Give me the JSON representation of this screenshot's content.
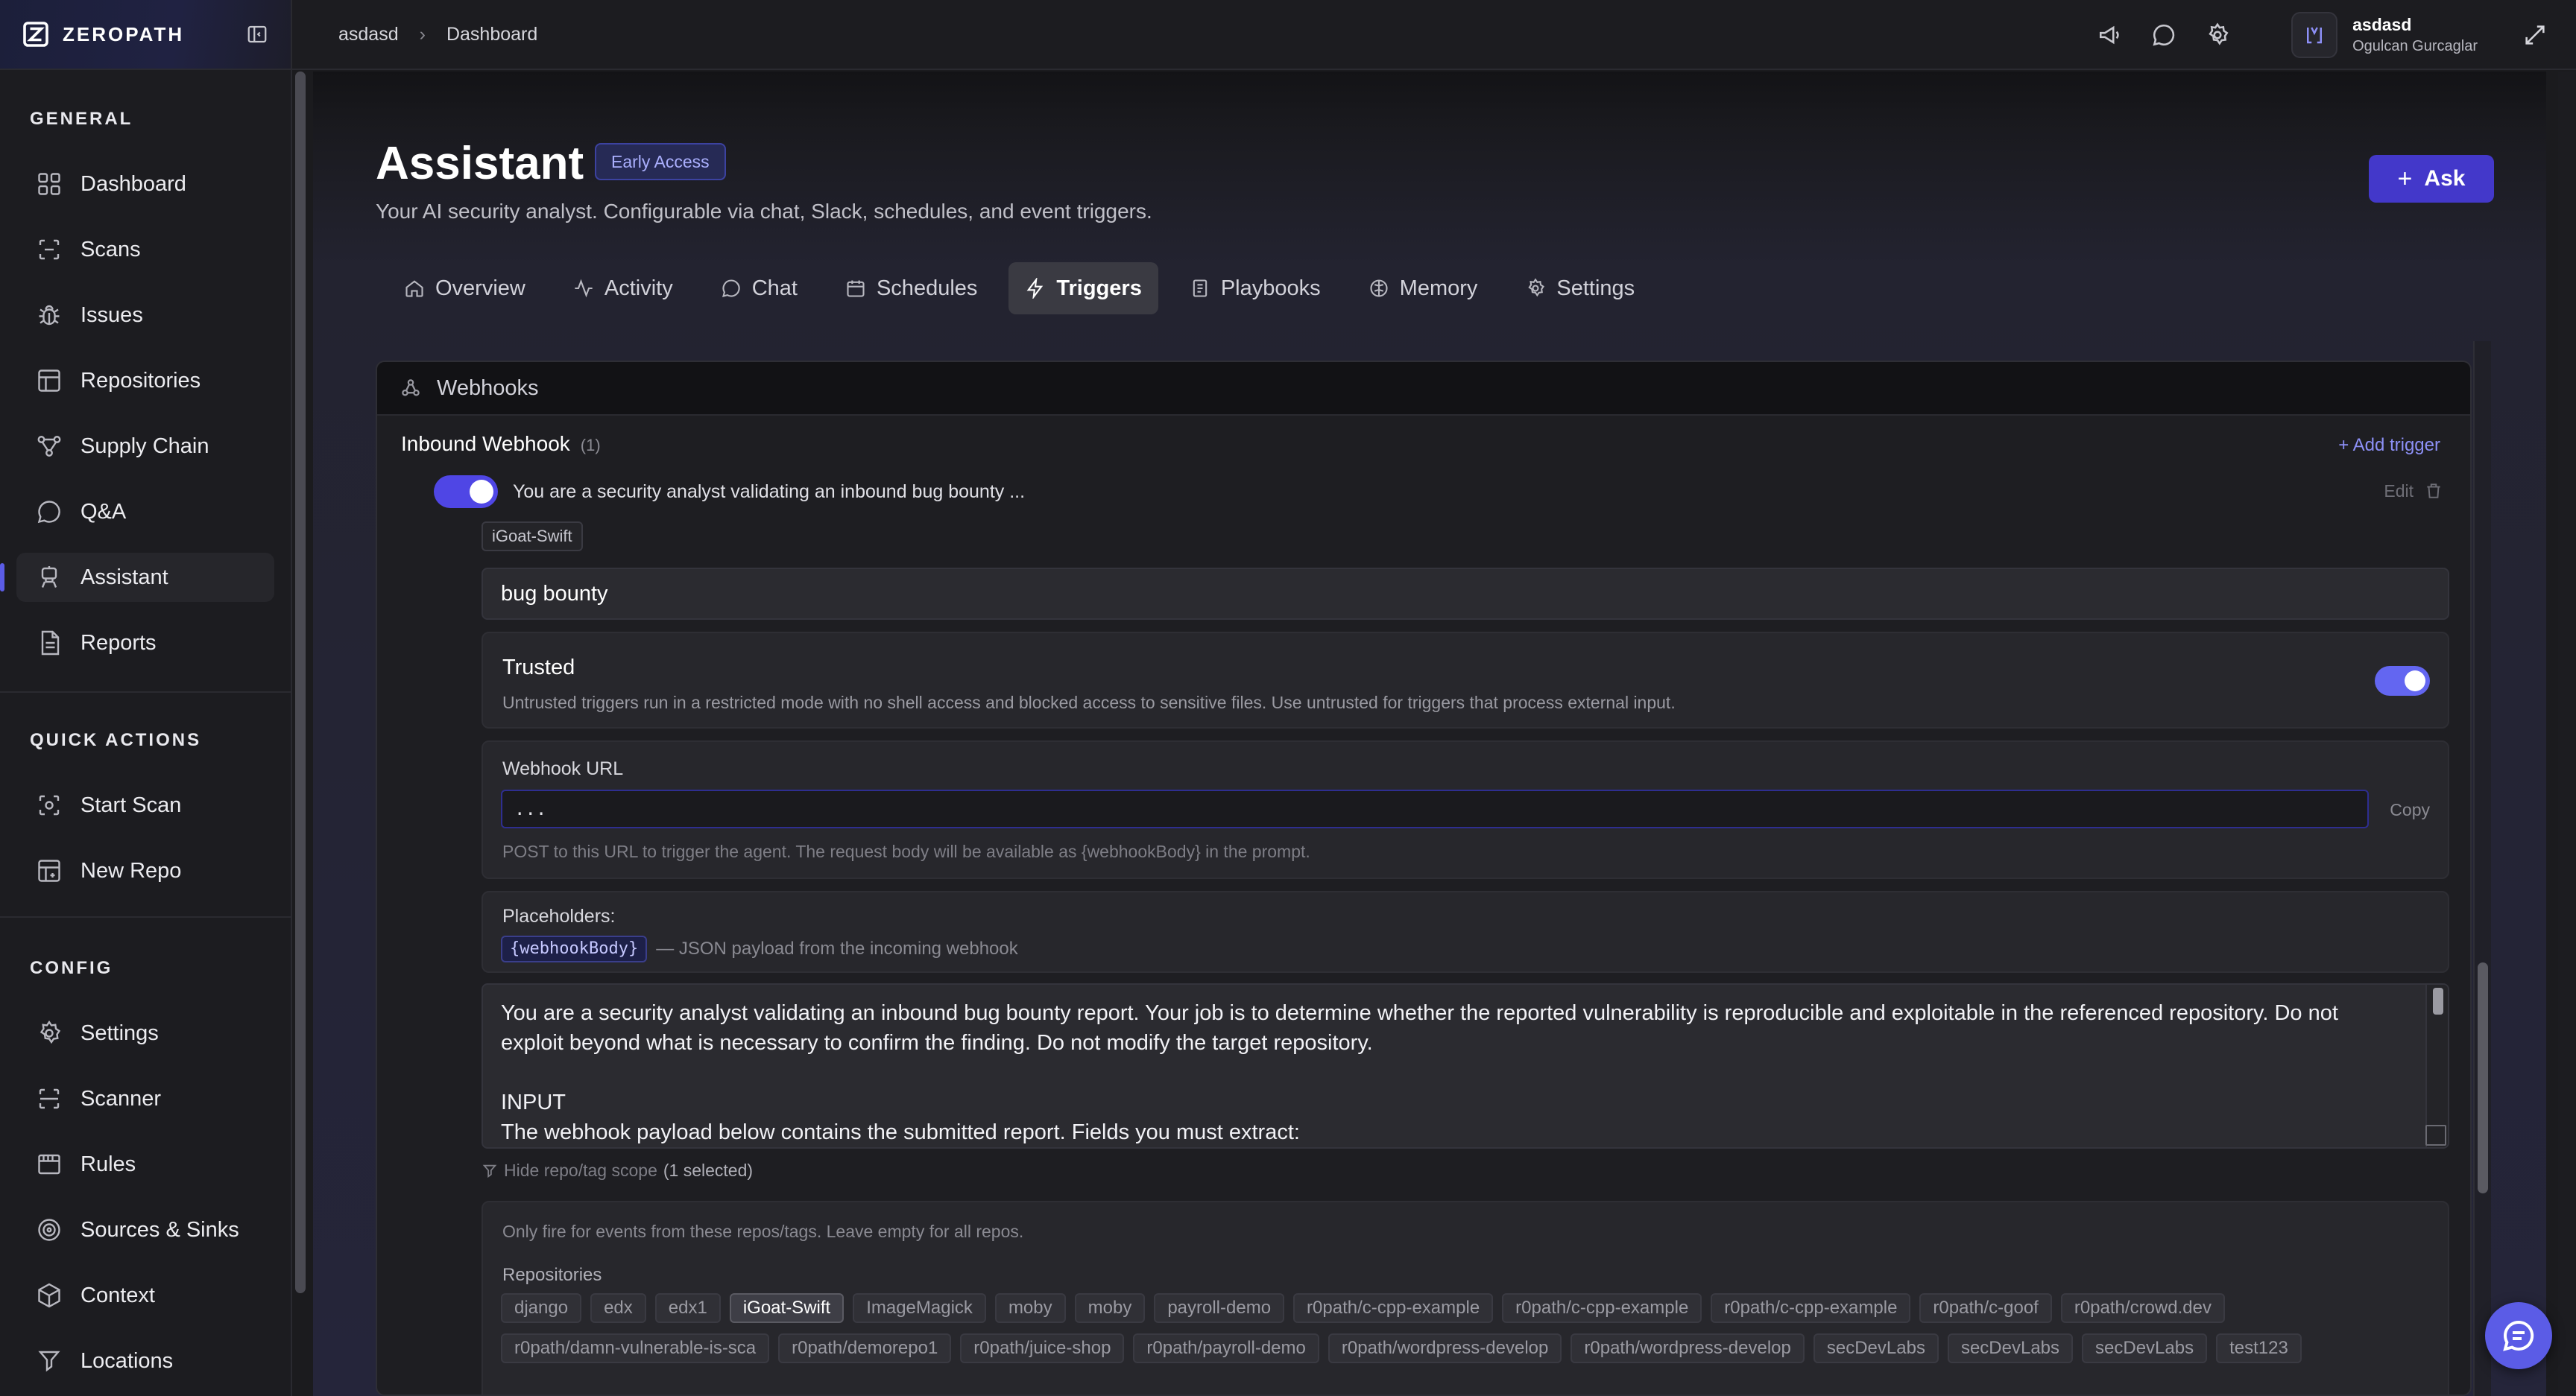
{
  "brand": {
    "name": "ZEROPATH"
  },
  "sidebar": {
    "general_title": "GENERAL",
    "general": [
      {
        "label": "Dashboard"
      },
      {
        "label": "Scans"
      },
      {
        "label": "Issues"
      },
      {
        "label": "Repositories"
      },
      {
        "label": "Supply Chain"
      },
      {
        "label": "Q&A"
      },
      {
        "label": "Assistant",
        "active": true
      },
      {
        "label": "Reports"
      }
    ],
    "quick_title": "QUICK ACTIONS",
    "quick": [
      {
        "label": "Start Scan"
      },
      {
        "label": "New Repo"
      }
    ],
    "config_title": "CONFIG",
    "config": [
      {
        "label": "Settings"
      },
      {
        "label": "Scanner"
      },
      {
        "label": "Rules"
      },
      {
        "label": "Sources & Sinks"
      },
      {
        "label": "Context"
      },
      {
        "label": "Locations"
      }
    ]
  },
  "topbar": {
    "breadcrumb": [
      "asdasd",
      "Dashboard"
    ],
    "user": {
      "org": "asdasd",
      "name": "Ogulcan Gurcaglar"
    }
  },
  "page": {
    "title": "Assistant",
    "badge": "Early Access",
    "subtitle": "Your AI security analyst. Configurable via chat, Slack, schedules, and event triggers.",
    "ask_label": "Ask"
  },
  "tabs": [
    {
      "label": "Overview",
      "icon": "home-icon"
    },
    {
      "label": "Activity",
      "icon": "activity-icon"
    },
    {
      "label": "Chat",
      "icon": "chat-icon"
    },
    {
      "label": "Schedules",
      "icon": "calendar-icon"
    },
    {
      "label": "Triggers",
      "icon": "bolt-icon",
      "active": true
    },
    {
      "label": "Playbooks",
      "icon": "playbook-icon"
    },
    {
      "label": "Memory",
      "icon": "brain-icon"
    },
    {
      "label": "Settings",
      "icon": "gear-icon"
    }
  ],
  "webhooks": {
    "header": "Webhooks",
    "inbound_title": "Inbound Webhook",
    "inbound_count": "(1)",
    "add_trigger": "+ Add trigger",
    "trigger": {
      "enabled": true,
      "summary": "You are a security analyst validating an inbound bug bounty ...",
      "edit_label": "Edit",
      "repo_chip": "iGoat-Swift",
      "name_value": "bug bounty",
      "trusted": {
        "title": "Trusted",
        "description": "Untrusted triggers run in a restricted mode with no shell access and blocked access to sensitive files. Use untrusted for triggers that process external input.",
        "enabled": true
      },
      "webhook_url": {
        "label": "Webhook URL",
        "value": "...",
        "copy_label": "Copy",
        "help": "POST to this URL to trigger the agent. The request body will be available as {webhookBody} in the prompt."
      },
      "placeholders": {
        "label": "Placeholders:",
        "tag": "{webhookBody}",
        "description": "— JSON payload from the incoming webhook"
      },
      "prompt": "You are a security analyst validating an inbound bug bounty report. Your job is to determine whether the reported vulnerability is reproducible and exploitable in the referenced repository. Do not exploit beyond what is necessary to confirm the finding. Do not modify the target repository.\n\nINPUT\nThe webhook payload below contains the submitted report. Fields you must extract:",
      "scope": {
        "toggle_label": "Hide repo/tag scope",
        "count": "(1 selected)",
        "help": "Only fire for events from these repos/tags. Leave empty for all repos.",
        "repositories_label": "Repositories",
        "repositories": [
          {
            "name": "django",
            "selected": false
          },
          {
            "name": "edx",
            "selected": false
          },
          {
            "name": "edx1",
            "selected": false
          },
          {
            "name": "iGoat-Swift",
            "selected": true
          },
          {
            "name": "ImageMagick",
            "selected": false
          },
          {
            "name": "moby",
            "selected": false
          },
          {
            "name": "moby",
            "selected": false
          },
          {
            "name": "payroll-demo",
            "selected": false
          },
          {
            "name": "r0path/c-cpp-example",
            "selected": false
          },
          {
            "name": "r0path/c-cpp-example",
            "selected": false
          },
          {
            "name": "r0path/c-cpp-example",
            "selected": false
          },
          {
            "name": "r0path/c-goof",
            "selected": false
          },
          {
            "name": "r0path/crowd.dev",
            "selected": false
          },
          {
            "name": "r0path/damn-vulnerable-is-sca",
            "selected": false
          },
          {
            "name": "r0path/demorepo1",
            "selected": false
          },
          {
            "name": "r0path/juice-shop",
            "selected": false
          },
          {
            "name": "r0path/payroll-demo",
            "selected": false
          },
          {
            "name": "r0path/wordpress-develop",
            "selected": false
          },
          {
            "name": "r0path/wordpress-develop",
            "selected": false
          },
          {
            "name": "secDevLabs",
            "selected": false
          },
          {
            "name": "secDevLabs",
            "selected": false
          },
          {
            "name": "secDevLabs",
            "selected": false
          },
          {
            "name": "test123",
            "selected": false
          }
        ]
      }
    }
  },
  "colors": {
    "accent": "#4f46e5",
    "accent_light": "#6366f1",
    "background": "#1b1b1e",
    "sidebar": "#1c1c20"
  }
}
